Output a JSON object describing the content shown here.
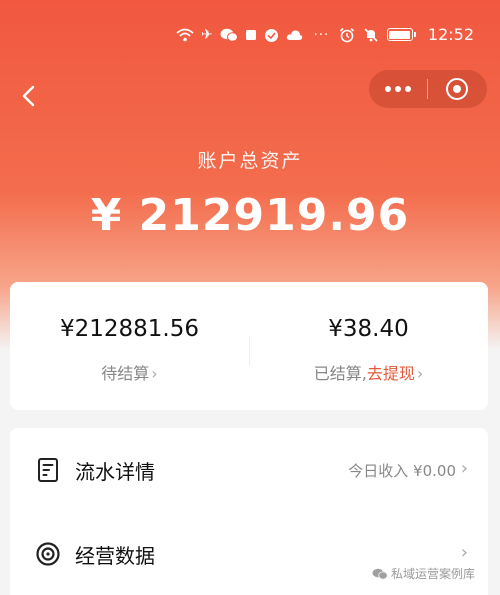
{
  "status_bar": {
    "time": "12:52",
    "left_icons": [
      "wifi-icon",
      "airplane-icon",
      "wechat-icon",
      "notification-icon",
      "app-icon",
      "cloud-icon",
      "more-dots-icon"
    ],
    "right_icons": [
      "alarm-icon",
      "mute-icon",
      "battery-icon"
    ]
  },
  "header": {
    "back_icon": "chevron-left-icon",
    "capsule": {
      "more_icon": "more-dots-icon",
      "close_icon": "target-icon"
    }
  },
  "assets": {
    "total_label": "账户总资产",
    "total_amount": "¥ 212919.96"
  },
  "balances": {
    "pending": {
      "amount": "¥212881.56",
      "label": "待结算"
    },
    "settled": {
      "amount": "¥38.40",
      "label": "已结算,",
      "action": "去提现"
    }
  },
  "menu": {
    "items": [
      {
        "icon": "document-icon",
        "label": "流水详情",
        "value": "今日收入 ¥0.00"
      },
      {
        "icon": "target-icon",
        "label": "经营数据",
        "value": ""
      }
    ]
  },
  "watermark": {
    "text": "私域运营案例库"
  },
  "colors": {
    "accent": "#f1583f",
    "link": "#e45a3c",
    "background": "#f4f4f4"
  }
}
